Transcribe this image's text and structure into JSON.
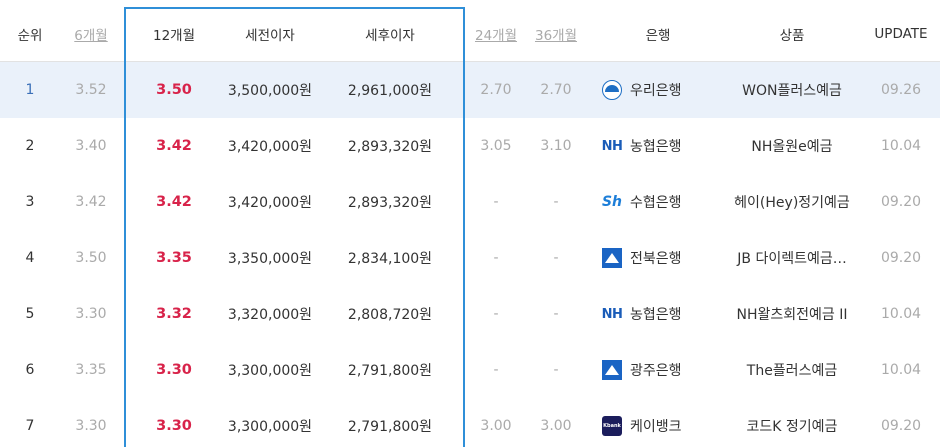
{
  "header": {
    "rank": "순위",
    "m6": "6개월",
    "m12": "12개월",
    "pretax": "세전이자",
    "aftertax": "세후이자",
    "m24": "24개월",
    "m36": "36개월",
    "bank": "은행",
    "product": "상품",
    "update": "UPDATE"
  },
  "rows": [
    {
      "rank": "1",
      "m6": "3.52",
      "m12": "3.50",
      "pretax": "3,500,000원",
      "aftertax": "2,961,000원",
      "m24": "2.70",
      "m36": "2.70",
      "bank": "우리은행",
      "bank_logo": "woori-logo-icon",
      "product": "WON플러스예금",
      "update": "09.26"
    },
    {
      "rank": "2",
      "m6": "3.40",
      "m12": "3.42",
      "pretax": "3,420,000원",
      "aftertax": "2,893,320원",
      "m24": "3.05",
      "m36": "3.10",
      "bank": "농협은행",
      "bank_logo": "nh-logo-icon",
      "logo_text": "NH",
      "product": "NH올원e예금",
      "update": "10.04"
    },
    {
      "rank": "3",
      "m6": "3.42",
      "m12": "3.42",
      "pretax": "3,420,000원",
      "aftertax": "2,893,320원",
      "m24": "-",
      "m36": "-",
      "bank": "수협은행",
      "bank_logo": "sh-logo-icon",
      "logo_text": "Sh",
      "product": "헤이(Hey)정기예금",
      "update": "09.20"
    },
    {
      "rank": "4",
      "m6": "3.50",
      "m12": "3.35",
      "pretax": "3,350,000원",
      "aftertax": "2,834,100원",
      "m24": "-",
      "m36": "-",
      "bank": "전북은행",
      "bank_logo": "jb-logo-icon",
      "product": "JB 다이렉트예금…",
      "update": "09.20"
    },
    {
      "rank": "5",
      "m6": "3.30",
      "m12": "3.32",
      "pretax": "3,320,000원",
      "aftertax": "2,808,720원",
      "m24": "-",
      "m36": "-",
      "bank": "농협은행",
      "bank_logo": "nh-logo-icon",
      "logo_text": "NH",
      "product": "NH왈츠회전예금 II",
      "update": "10.04"
    },
    {
      "rank": "6",
      "m6": "3.35",
      "m12": "3.30",
      "pretax": "3,300,000원",
      "aftertax": "2,791,800원",
      "m24": "-",
      "m36": "-",
      "bank": "광주은행",
      "bank_logo": "jb-logo-icon",
      "product": "The플러스예금",
      "update": "10.04"
    },
    {
      "rank": "7",
      "m6": "3.30",
      "m12": "3.30",
      "pretax": "3,300,000원",
      "aftertax": "2,791,800원",
      "m24": "3.00",
      "m36": "3.00",
      "bank": "케이뱅크",
      "bank_logo": "kbank-logo-icon",
      "logo_text": "Kbank",
      "product": "코드K 정기예금",
      "update": "09.20"
    }
  ],
  "colors": {
    "rate_highlight": "#d8234a",
    "column_box_border": "#2f8fd8",
    "selected_row_bg": "#eaf1fa"
  }
}
